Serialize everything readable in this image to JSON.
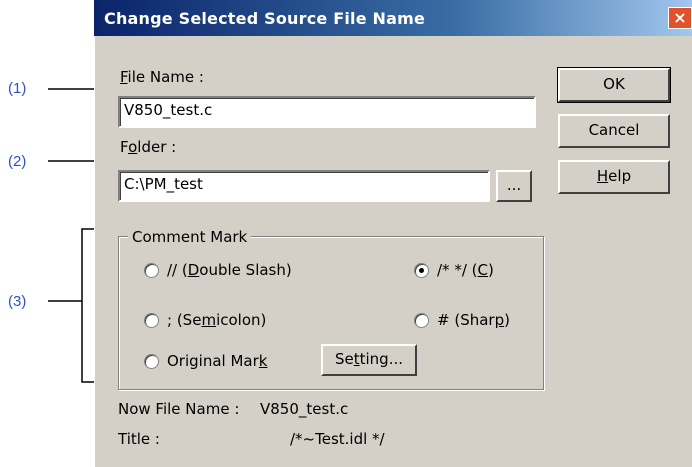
{
  "callouts": [
    "(1)",
    "(2)",
    "(3)"
  ],
  "dialog": {
    "title": "Change Selected Source File Name",
    "close_glyph": "×",
    "file_name_label_hotkey": "F",
    "file_name_label_rest": "ile Name :",
    "file_name_value": "V850_test.c",
    "folder_label_pre": "F",
    "folder_label_hotkey": "o",
    "folder_label_rest": "lder :",
    "folder_value": "C:\\PM_test",
    "browse_label": "...",
    "ok_label": "OK",
    "cancel_label": "Cancel",
    "help_hotkey": "H",
    "help_rest": "elp",
    "comment_mark": {
      "title": "Comment Mark",
      "double_slash_pre": "// (",
      "double_slash_hotkey": "D",
      "double_slash_post": "ouble Slash)",
      "c_pre": "/* */ (",
      "c_hotkey": "C",
      "c_post": ")",
      "semicolon_pre": "; (Se",
      "semicolon_hotkey": "m",
      "semicolon_post": "icolon)",
      "sharp_pre": "# (Shar",
      "sharp_hotkey": "p",
      "sharp_post": ")",
      "original_pre": "Original Mar",
      "original_hotkey": "k",
      "setting_pre": "Se",
      "setting_hotkey": "t",
      "setting_post": "ting...",
      "selected": "c"
    },
    "now_file_name_label": "Now File Name :",
    "now_file_name_value": "V850_test.c",
    "title_label": "Title :",
    "title_value": "/*~Test.idl */"
  }
}
